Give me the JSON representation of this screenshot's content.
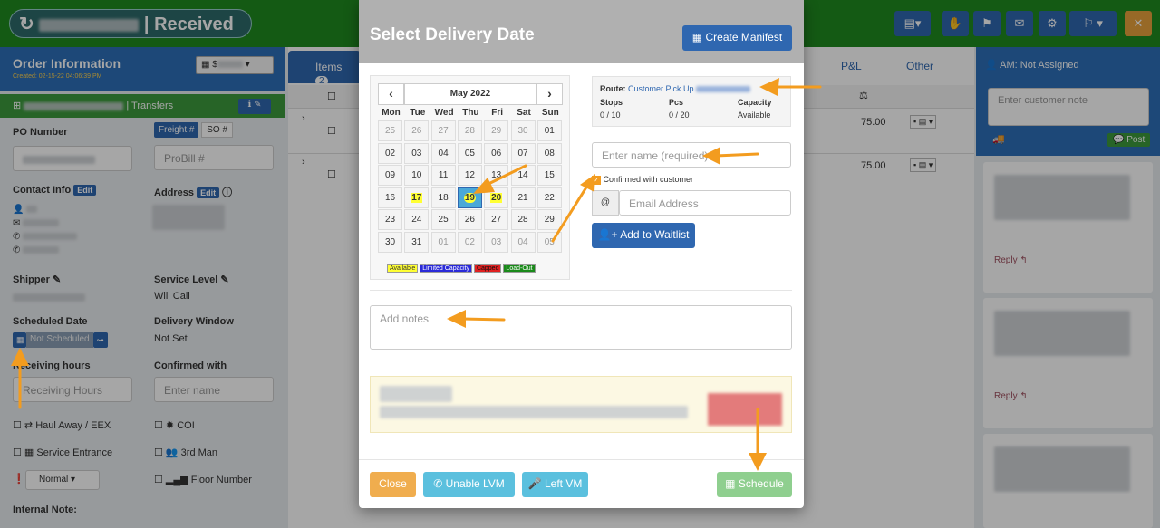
{
  "header": {
    "title": "Received"
  },
  "order_info": {
    "title": "Order Information",
    "created": "Created: 02-15-22 04:06:39 PM",
    "select_value": "$"
  },
  "transfers": {
    "label": "| Transfers"
  },
  "fields": {
    "po_number": "PO Number",
    "freight_tab": "Freight #",
    "so_tab": "SO #",
    "probill_placeholder": "ProBill #",
    "contact_info": "Contact Info",
    "address": "Address",
    "edit": "Edit",
    "shipper": "Shipper",
    "service_level": "Service Level",
    "service_level_value": "Will Call",
    "scheduled_date": "Scheduled Date",
    "not_scheduled": "Not Scheduled",
    "delivery_window": "Delivery Window",
    "delivery_window_value": "Not Set",
    "receiving_hours": "Receiving hours",
    "receiving_placeholder": "Receiving Hours",
    "confirmed_with": "Confirmed with",
    "enter_name": "Enter name",
    "haul_away": "Haul Away / EEX",
    "coi": "COI",
    "service_entrance": "Service Entrance",
    "third_man": "3rd Man",
    "priority": "Normal",
    "floor_number": "Floor Number",
    "internal_note": "Internal Note:"
  },
  "tabs": {
    "items": "Items",
    "items_count": "2",
    "pl": "P&L",
    "other": "Other"
  },
  "table": {
    "row1_price": "75.00",
    "row2_price": "75.00"
  },
  "right": {
    "am": "AM: Not Assigned",
    "customer_note_placeholder": "Enter customer note",
    "post": "Post",
    "reply": "Reply"
  },
  "modal": {
    "title": "Select Delivery Date",
    "create_manifest": "Create Manifest",
    "calendar": {
      "month": "May 2022",
      "prev": "‹",
      "next": "›",
      "weekdays": [
        "Mon",
        "Tue",
        "Wed",
        "Thu",
        "Fri",
        "Sat",
        "Sun"
      ],
      "days": [
        [
          "25",
          "26",
          "27",
          "28",
          "29",
          "30",
          "01"
        ],
        [
          "02",
          "03",
          "04",
          "05",
          "06",
          "07",
          "08"
        ],
        [
          "09",
          "10",
          "11",
          "12",
          "13",
          "14",
          "15"
        ],
        [
          "16",
          "17",
          "18",
          "19",
          "20",
          "21",
          "22"
        ],
        [
          "23",
          "24",
          "25",
          "26",
          "27",
          "28",
          "29"
        ],
        [
          "30",
          "31",
          "01",
          "02",
          "03",
          "04",
          "05"
        ]
      ]
    },
    "legend": {
      "available": "Available",
      "limited": "Limited Capacity",
      "capped": "Capped",
      "load_out": "Load-Out"
    },
    "route": {
      "label": "Route:",
      "value": "Customer Pick Up",
      "stops_label": "Stops",
      "stops_value": "0 / 10",
      "pcs_label": "Pcs",
      "pcs_value": "0 / 20",
      "capacity_label": "Capacity",
      "capacity_value": "Available"
    },
    "name_placeholder": "Enter name (required)",
    "confirmed_label": "Confirmed with customer",
    "email_at": "@",
    "email_placeholder": "Email Address",
    "add_waitlist": "Add to Waitlist",
    "notes_placeholder": "Add notes",
    "close": "Close",
    "unable_lvm": "Unable LVM",
    "left_vm": "Left VM",
    "schedule": "Schedule"
  },
  "colors": {
    "green": "#1f8a1f",
    "blue": "#2f67b0",
    "orange": "#f39c1f",
    "yellow": "#ffff33",
    "selected": "#4aa8d8"
  }
}
